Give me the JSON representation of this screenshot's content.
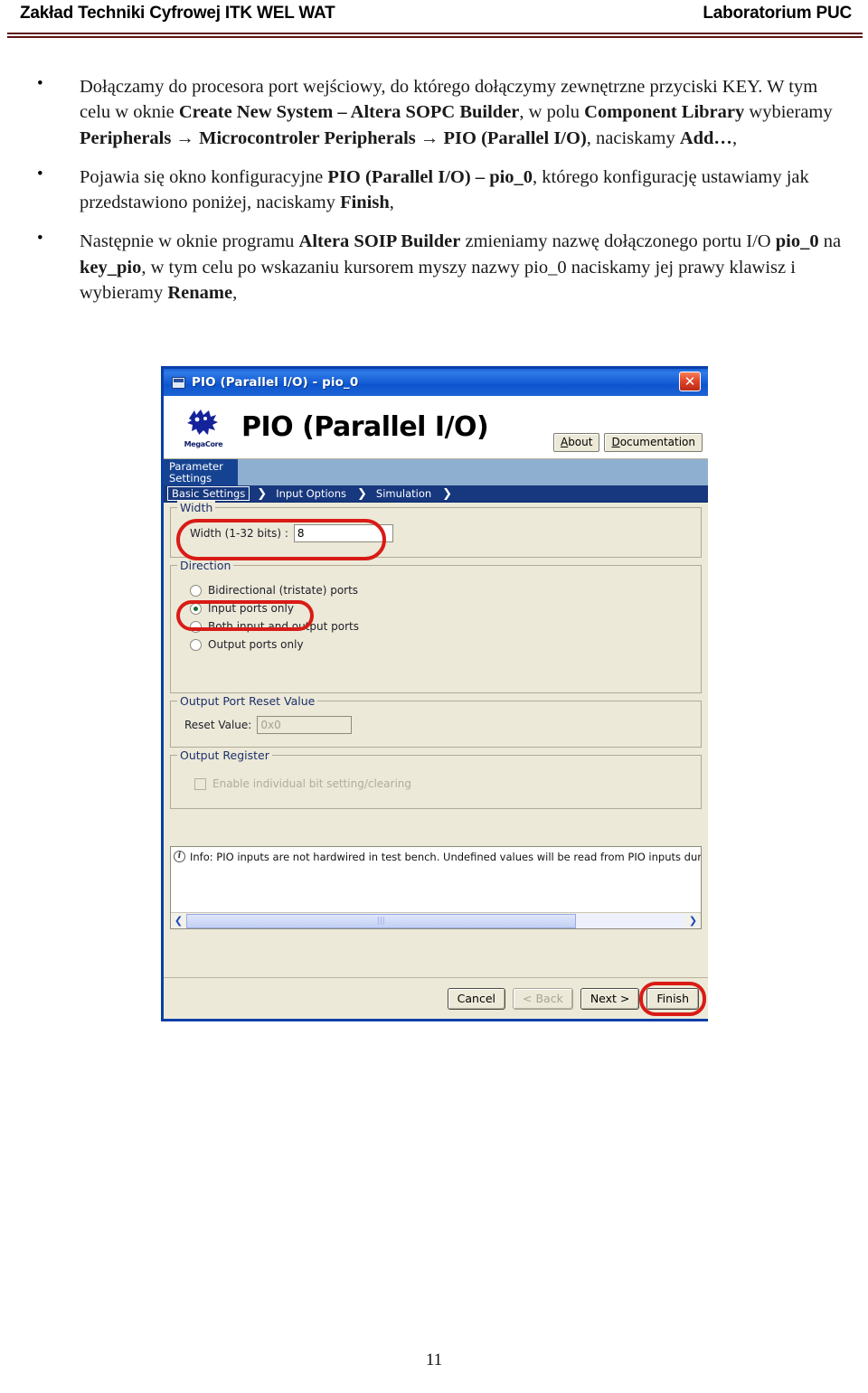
{
  "header": {
    "left_title": "Zakład Techniki Cyfrowej ITK WEL WAT",
    "right_title": "Laboratorium PUC"
  },
  "body": {
    "bullets": [
      {
        "id": "bullet-1",
        "html": "Dołączamy do procesora port wejściowy, do którego dołączymy zewnętrzne przyciski KEY. W tym celu w oknie <b>Create New System &ndash; Altera SOPC Builder</b>, w polu <b>Component Library</b> wybieramy <b>Peripherals &rarr; Microcontroler Peripherals &rarr; PIO (Parallel I/O)</b>, naciskamy <b>Add&hellip;</b>,"
      },
      {
        "id": "bullet-2",
        "html": "Pojawia się okno konfiguracyjne <b>PIO (Parallel I/O) &ndash; pio_0</b>, którego konfigurację ustawiamy jak przedstawiono poniżej, naciskamy <b>Finish</b>,"
      },
      {
        "id": "bullet-3",
        "html": "Następnie w oknie programu <b>Altera SOIP Builder</b> zmieniamy nazwę dołączonego portu I/O <b>pio_0</b> na <b>key_pio</b>, w tym celu po wskazaniu kursorem myszy nazwy pio_0 naciskamy jej prawy klawisz i wybieramy <b>Rename</b>,"
      }
    ]
  },
  "dialog": {
    "title": "PIO (Parallel I/O) - pio_0",
    "close_label": "✕",
    "banner": {
      "heading": "PIO (Parallel I/O)",
      "logo_text": "MegaCore",
      "about_label": "About",
      "documentation_label": "Documentation"
    },
    "nav": {
      "tab_label_line1": "Parameter",
      "tab_label_line2": "Settings",
      "crumbs": [
        "Basic Settings",
        "Input Options",
        "Simulation"
      ],
      "active_crumb": "Basic Settings",
      "chevron": "❯"
    },
    "groups": {
      "width": {
        "title": "Width",
        "field_label": "Width (1-32 bits) :",
        "field_value": "8"
      },
      "direction": {
        "title": "Direction",
        "options": [
          {
            "label": "Bidirectional (tristate) ports",
            "selected": false
          },
          {
            "label": "Input ports only",
            "selected": true
          },
          {
            "label": "Both input and output ports",
            "selected": false
          },
          {
            "label": "Output ports only",
            "selected": false
          }
        ]
      },
      "output_port_reset": {
        "title": "Output Port Reset Value",
        "field_label": "Reset Value:",
        "field_value": "0x0",
        "disabled": true
      },
      "output_register": {
        "title": "Output Register",
        "checkbox_label": "Enable individual bit setting/clearing",
        "checked": false,
        "disabled": true
      }
    },
    "info": {
      "icon_char": "i",
      "message": "Info: PIO inputs are not hardwired in test bench. Undefined values will be read from PIO inputs dur",
      "scroll_left": "❮",
      "scroll_right": "❯"
    },
    "footer": {
      "cancel_label": "Cancel",
      "back_label": "< Back",
      "next_label": "Next >",
      "finish_label": "Finish"
    },
    "accent_color": "#d91b16",
    "titlebar_color": "#0d55cf",
    "surface_color": "#ece9d8"
  },
  "footer": {
    "page_number": "11"
  }
}
